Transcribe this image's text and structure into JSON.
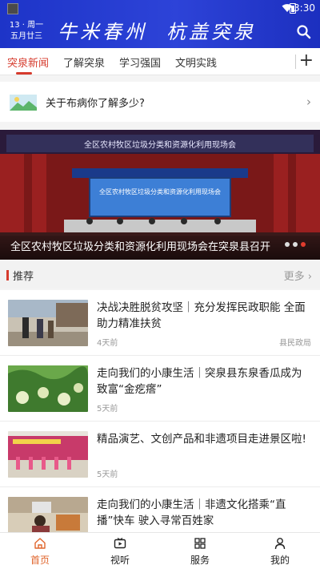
{
  "status_bar": {
    "time": "3:30"
  },
  "header": {
    "date_line1": "13 · 周一",
    "date_line2": "五月廿三",
    "slogan_part1": "牛米春州",
    "slogan_part2": "杭盖突泉",
    "search_icon": "search-icon"
  },
  "tabs": [
    {
      "label": "突泉新闻",
      "active": true
    },
    {
      "label": "了解突泉",
      "active": false
    },
    {
      "label": "学习强国",
      "active": false
    },
    {
      "label": "文明实践",
      "active": false
    }
  ],
  "tabs_add_label": "+",
  "notice": {
    "text": "关于布病你了解多少?",
    "chevron": "›"
  },
  "banner": {
    "stage_text": "全区农村牧区垃圾分类和资源化利用现场会",
    "screen_text": "全区农村牧区垃圾分类和资源化利用现场会",
    "caption": "全区农村牧区垃圾分类和资源化利用现场会在突泉县召开",
    "dots": 3,
    "active_dot": 2
  },
  "recommend": {
    "title": "推荐",
    "more": "更多 ›"
  },
  "news": [
    {
      "title": "决战决胜脱贫攻坚｜充分发挥民政职能 全面助力精准扶贫",
      "time": "4天前",
      "source": "县民政局"
    },
    {
      "title": "走向我们的小康生活｜突泉县东泉香瓜成为致富“金疙瘩”",
      "time": "5天前",
      "source": ""
    },
    {
      "title": "精品演艺、文创产品和非遗项目走进景区啦!",
      "time": "5天前",
      "source": ""
    },
    {
      "title": "走向我们的小康生活｜非遗文化搭乘“直播”快车 驶入寻常百姓家",
      "time": "",
      "source": ""
    }
  ],
  "bottom_nav": [
    {
      "label": "首页",
      "icon": "home-icon",
      "active": true
    },
    {
      "label": "视听",
      "icon": "video-icon",
      "active": false
    },
    {
      "label": "服务",
      "icon": "grid-icon",
      "active": false
    },
    {
      "label": "我的",
      "icon": "user-icon",
      "active": false
    }
  ],
  "colors": {
    "header_blue": "#2d43d8",
    "accent_red": "#d63b2d",
    "nav_active": "#e0662d"
  }
}
